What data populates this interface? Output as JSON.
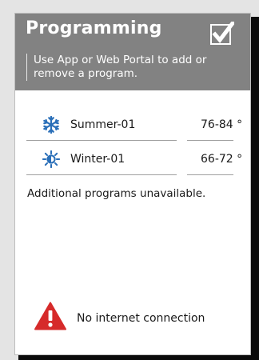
{
  "header": {
    "title": "Programming",
    "subtitle": "Use App or Web Portal to add or remove a program.",
    "check_icon": "checkbox-check-icon"
  },
  "programs": [
    {
      "name": "Summer-01",
      "temp": "76-84 °",
      "icon": "snowflake-icon"
    },
    {
      "name": "Winter-01",
      "temp": "66-72 °",
      "icon": "sun-icon"
    }
  ],
  "notice": "Additional programs unavailable.",
  "status": {
    "text": "No internet connection",
    "icon": "warning-icon"
  },
  "colors": {
    "header_bg": "#828282",
    "icon_blue": "#2a6fb8",
    "warning_red": "#d62a2a"
  }
}
